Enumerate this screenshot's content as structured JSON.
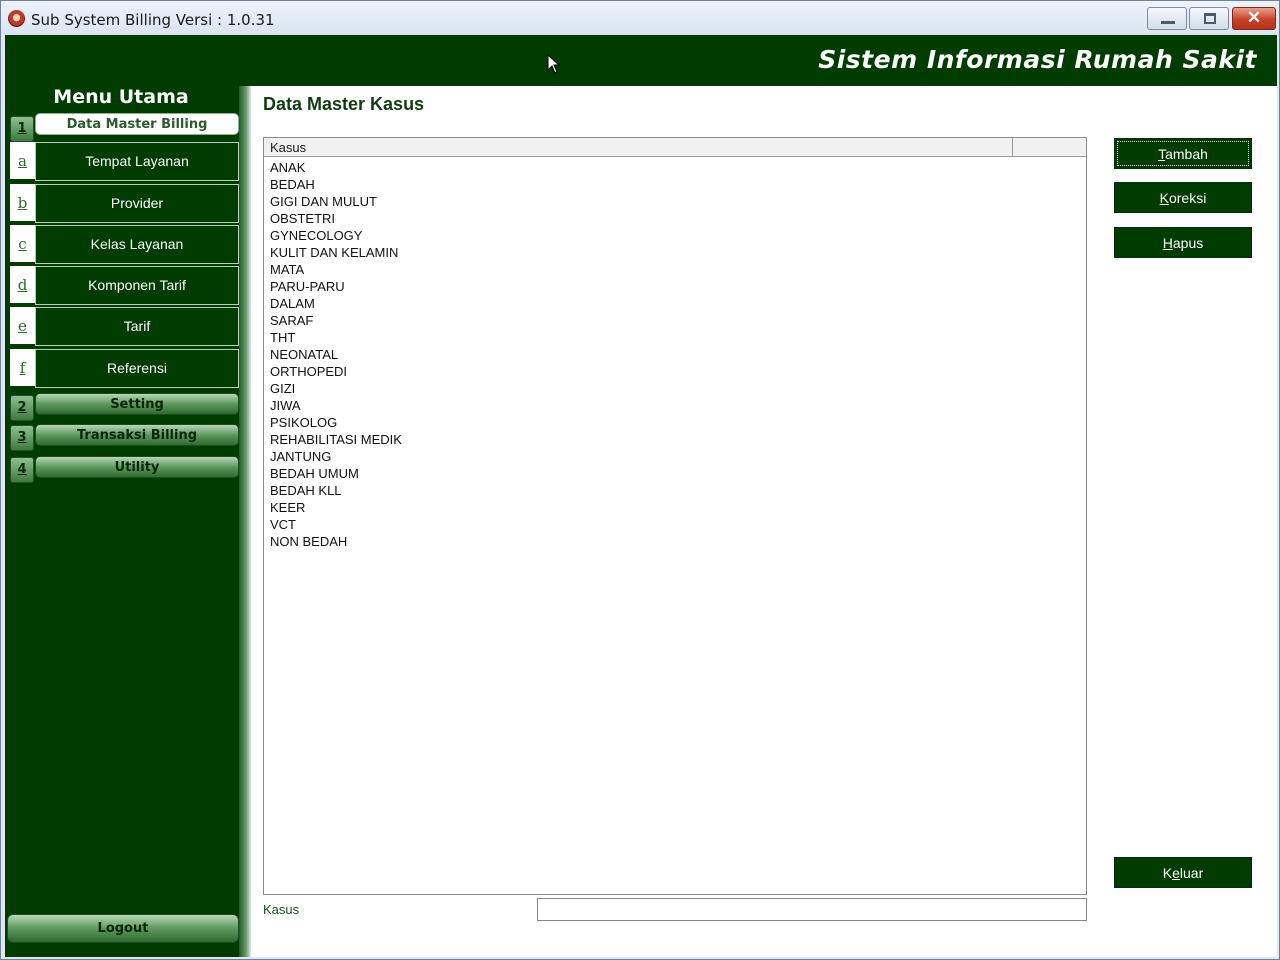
{
  "window": {
    "title": "Sub System Billing Versi : 1.0.31",
    "controls": {
      "minimize": "minimize",
      "maximize": "maximize",
      "close": "close"
    }
  },
  "banner": {
    "title": "Sistem Informasi Rumah Sakit"
  },
  "sidebar": {
    "title": "Menu Utama",
    "groups": [
      {
        "key": "1",
        "label": "Data Master Billing",
        "active": true
      },
      {
        "key": "2",
        "label": "Setting"
      },
      {
        "key": "3",
        "label": "Transaksi Billing"
      },
      {
        "key": "4",
        "label": "Utility"
      }
    ],
    "subitems": [
      {
        "key": "a",
        "label": "Tempat Layanan"
      },
      {
        "key": "b",
        "label": "Provider"
      },
      {
        "key": "c",
        "label": "Kelas Layanan"
      },
      {
        "key": "d",
        "label": "Komponen Tarif"
      },
      {
        "key": "e",
        "label": "Tarif"
      },
      {
        "key": "f",
        "label": "Referensi"
      }
    ],
    "logout_label": "Logout"
  },
  "main": {
    "title": "Data Master Kasus",
    "grid": {
      "column_header": "Kasus",
      "rows": [
        "ANAK",
        "BEDAH",
        "GIGI DAN MULUT",
        "OBSTETRI",
        "GYNECOLOGY",
        "KULIT DAN KELAMIN",
        "MATA",
        "PARU-PARU",
        "DALAM",
        "SARAF",
        "THT",
        "NEONATAL",
        "ORTHOPEDI",
        "GIZI",
        "JIWA",
        "PSIKOLOG",
        "REHABILITASI MEDIK",
        "JANTUNG",
        "BEDAH UMUM",
        "BEDAH KLL",
        "KEER",
        "VCT",
        "NON BEDAH"
      ]
    },
    "field": {
      "label": "Kasus",
      "value": ""
    },
    "buttons": {
      "tambah": {
        "hotkey": "T",
        "rest": "ambah"
      },
      "koreksi": {
        "hotkey": "K",
        "rest": "oreksi"
      },
      "hapus": {
        "hotkey": "H",
        "rest": "apus"
      },
      "keluar": {
        "pre": "K",
        "hotkey": "e",
        "rest": "luar"
      }
    }
  },
  "colors": {
    "primary_green": "#003b00",
    "accent_green": "#5e985e",
    "window_chrome": "#dfe8f3"
  }
}
